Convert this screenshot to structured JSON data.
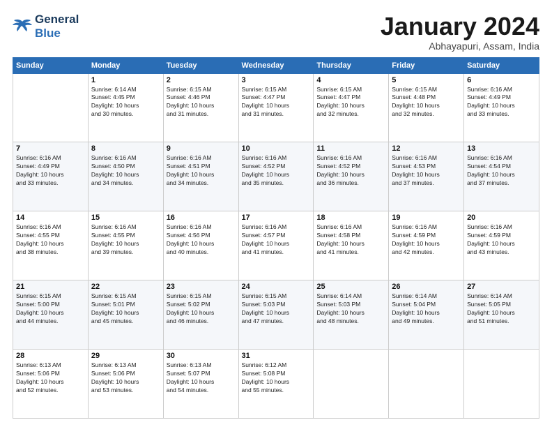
{
  "logo": {
    "line1": "General",
    "line2": "Blue"
  },
  "title": "January 2024",
  "subtitle": "Abhayapuri, Assam, India",
  "weekdays": [
    "Sunday",
    "Monday",
    "Tuesday",
    "Wednesday",
    "Thursday",
    "Friday",
    "Saturday"
  ],
  "weeks": [
    [
      {
        "day": "",
        "info": ""
      },
      {
        "day": "1",
        "info": "Sunrise: 6:14 AM\nSunset: 4:45 PM\nDaylight: 10 hours\nand 30 minutes."
      },
      {
        "day": "2",
        "info": "Sunrise: 6:15 AM\nSunset: 4:46 PM\nDaylight: 10 hours\nand 31 minutes."
      },
      {
        "day": "3",
        "info": "Sunrise: 6:15 AM\nSunset: 4:47 PM\nDaylight: 10 hours\nand 31 minutes."
      },
      {
        "day": "4",
        "info": "Sunrise: 6:15 AM\nSunset: 4:47 PM\nDaylight: 10 hours\nand 32 minutes."
      },
      {
        "day": "5",
        "info": "Sunrise: 6:15 AM\nSunset: 4:48 PM\nDaylight: 10 hours\nand 32 minutes."
      },
      {
        "day": "6",
        "info": "Sunrise: 6:16 AM\nSunset: 4:49 PM\nDaylight: 10 hours\nand 33 minutes."
      }
    ],
    [
      {
        "day": "7",
        "info": "Sunrise: 6:16 AM\nSunset: 4:49 PM\nDaylight: 10 hours\nand 33 minutes."
      },
      {
        "day": "8",
        "info": "Sunrise: 6:16 AM\nSunset: 4:50 PM\nDaylight: 10 hours\nand 34 minutes."
      },
      {
        "day": "9",
        "info": "Sunrise: 6:16 AM\nSunset: 4:51 PM\nDaylight: 10 hours\nand 34 minutes."
      },
      {
        "day": "10",
        "info": "Sunrise: 6:16 AM\nSunset: 4:52 PM\nDaylight: 10 hours\nand 35 minutes."
      },
      {
        "day": "11",
        "info": "Sunrise: 6:16 AM\nSunset: 4:52 PM\nDaylight: 10 hours\nand 36 minutes."
      },
      {
        "day": "12",
        "info": "Sunrise: 6:16 AM\nSunset: 4:53 PM\nDaylight: 10 hours\nand 37 minutes."
      },
      {
        "day": "13",
        "info": "Sunrise: 6:16 AM\nSunset: 4:54 PM\nDaylight: 10 hours\nand 37 minutes."
      }
    ],
    [
      {
        "day": "14",
        "info": "Sunrise: 6:16 AM\nSunset: 4:55 PM\nDaylight: 10 hours\nand 38 minutes."
      },
      {
        "day": "15",
        "info": "Sunrise: 6:16 AM\nSunset: 4:55 PM\nDaylight: 10 hours\nand 39 minutes."
      },
      {
        "day": "16",
        "info": "Sunrise: 6:16 AM\nSunset: 4:56 PM\nDaylight: 10 hours\nand 40 minutes."
      },
      {
        "day": "17",
        "info": "Sunrise: 6:16 AM\nSunset: 4:57 PM\nDaylight: 10 hours\nand 41 minutes."
      },
      {
        "day": "18",
        "info": "Sunrise: 6:16 AM\nSunset: 4:58 PM\nDaylight: 10 hours\nand 41 minutes."
      },
      {
        "day": "19",
        "info": "Sunrise: 6:16 AM\nSunset: 4:59 PM\nDaylight: 10 hours\nand 42 minutes."
      },
      {
        "day": "20",
        "info": "Sunrise: 6:16 AM\nSunset: 4:59 PM\nDaylight: 10 hours\nand 43 minutes."
      }
    ],
    [
      {
        "day": "21",
        "info": "Sunrise: 6:15 AM\nSunset: 5:00 PM\nDaylight: 10 hours\nand 44 minutes."
      },
      {
        "day": "22",
        "info": "Sunrise: 6:15 AM\nSunset: 5:01 PM\nDaylight: 10 hours\nand 45 minutes."
      },
      {
        "day": "23",
        "info": "Sunrise: 6:15 AM\nSunset: 5:02 PM\nDaylight: 10 hours\nand 46 minutes."
      },
      {
        "day": "24",
        "info": "Sunrise: 6:15 AM\nSunset: 5:03 PM\nDaylight: 10 hours\nand 47 minutes."
      },
      {
        "day": "25",
        "info": "Sunrise: 6:14 AM\nSunset: 5:03 PM\nDaylight: 10 hours\nand 48 minutes."
      },
      {
        "day": "26",
        "info": "Sunrise: 6:14 AM\nSunset: 5:04 PM\nDaylight: 10 hours\nand 49 minutes."
      },
      {
        "day": "27",
        "info": "Sunrise: 6:14 AM\nSunset: 5:05 PM\nDaylight: 10 hours\nand 51 minutes."
      }
    ],
    [
      {
        "day": "28",
        "info": "Sunrise: 6:13 AM\nSunset: 5:06 PM\nDaylight: 10 hours\nand 52 minutes."
      },
      {
        "day": "29",
        "info": "Sunrise: 6:13 AM\nSunset: 5:06 PM\nDaylight: 10 hours\nand 53 minutes."
      },
      {
        "day": "30",
        "info": "Sunrise: 6:13 AM\nSunset: 5:07 PM\nDaylight: 10 hours\nand 54 minutes."
      },
      {
        "day": "31",
        "info": "Sunrise: 6:12 AM\nSunset: 5:08 PM\nDaylight: 10 hours\nand 55 minutes."
      },
      {
        "day": "",
        "info": ""
      },
      {
        "day": "",
        "info": ""
      },
      {
        "day": "",
        "info": ""
      }
    ]
  ]
}
